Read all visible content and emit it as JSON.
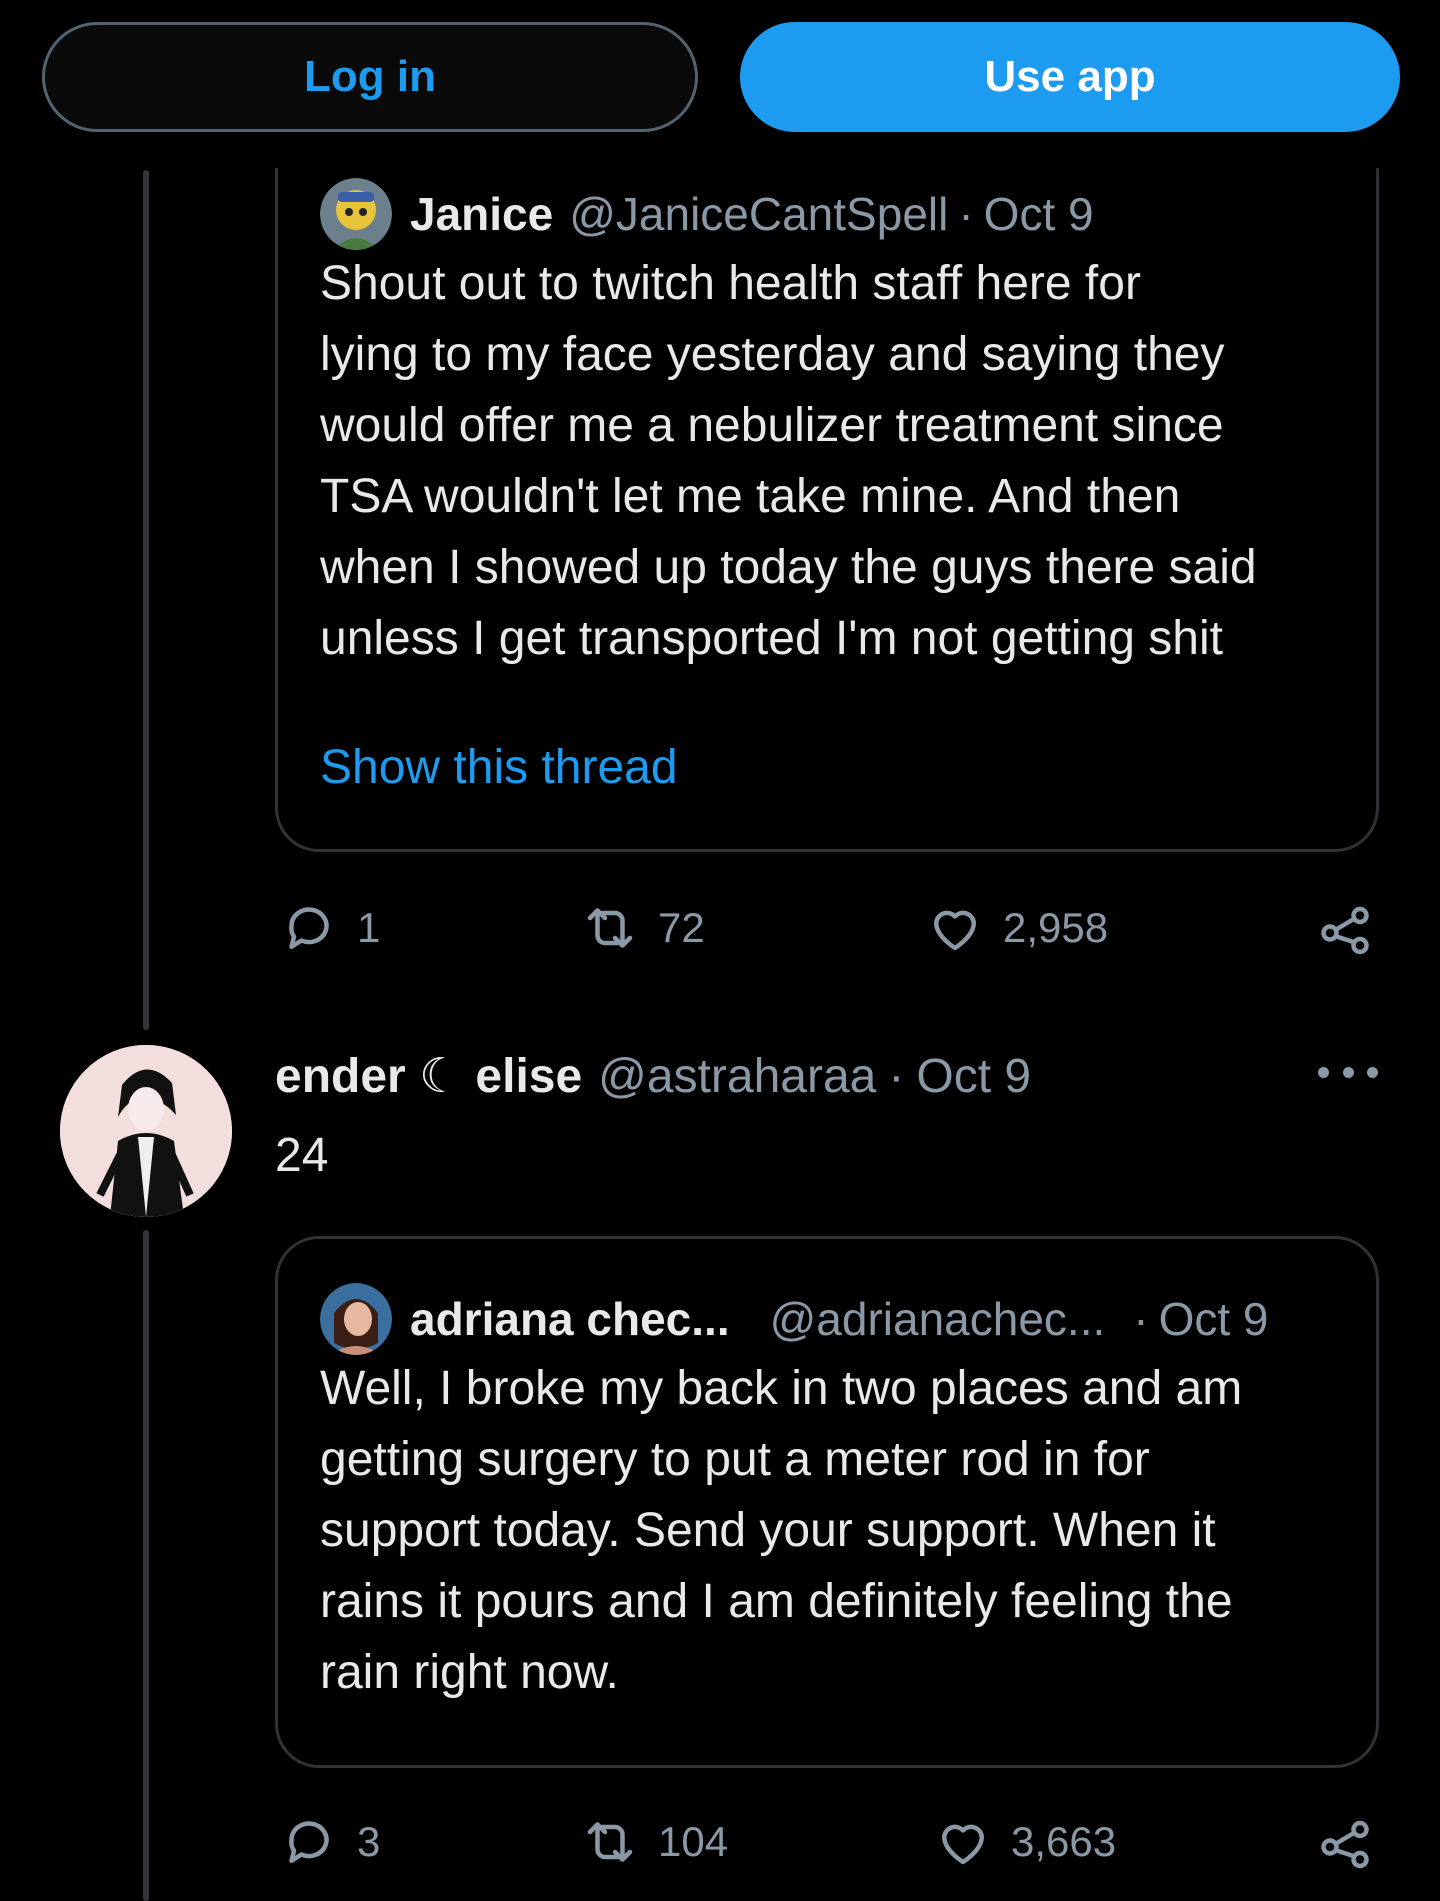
{
  "topbar": {
    "login_label": "Log in",
    "app_label": "Use app"
  },
  "quote1": {
    "name": "Janice",
    "handle": "@JaniceCantSpell",
    "date": "Oct 9",
    "lines": [
      "Shout out to twitch health staff here for",
      "lying to my face yesterday and saying they",
      "would offer me a nebulizer treatment since",
      "TSA wouldn't let me take mine. And then",
      "when I showed up today the guys there said",
      "unless I get transported I'm not getting shit"
    ],
    "show_thread": "Show this thread"
  },
  "actions1": {
    "replies": "1",
    "retweets": "72",
    "likes": "2,958"
  },
  "tweet": {
    "name": "ender ☾ elise",
    "handle": "@astraharaa",
    "date": "Oct 9",
    "text": "24"
  },
  "quote2": {
    "name": "adriana chec...",
    "handle": "@adrianachec...",
    "date": "Oct 9",
    "lines": [
      "Well, I broke my back in two places and am",
      "getting surgery to put a meter rod in for",
      "support today. Send your support. When it",
      "rains it pours and I am definitely feeling the",
      "rain right now."
    ]
  },
  "actions2": {
    "replies": "3",
    "retweets": "104",
    "likes": "3,663"
  },
  "dot": "·",
  "icons": {
    "reply": "reply-icon",
    "retweet": "retweet-icon",
    "like": "heart-icon",
    "share": "share-icon",
    "more": "more-icon"
  },
  "colors": {
    "accent": "#1d9bf0",
    "muted": "#8b98a5",
    "border": "#2f3336"
  }
}
